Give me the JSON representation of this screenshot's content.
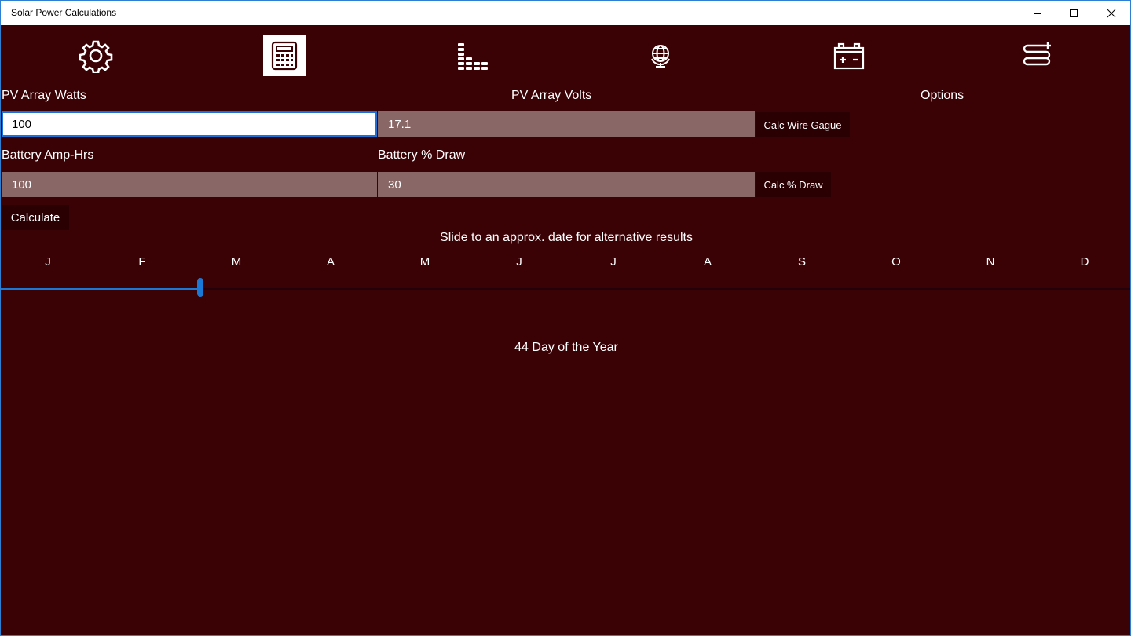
{
  "window": {
    "title": "Solar Power Calculations"
  },
  "labels": {
    "pv_watts": "PV Array Watts",
    "pv_volts": "PV Array Volts",
    "options": "Options",
    "battery_amp_hrs": "Battery Amp-Hrs",
    "battery_draw": "Battery % Draw",
    "slide_hint": "Slide to an approx. date for alternative results",
    "day_suffix": "Day of the Year"
  },
  "fields": {
    "pv_watts": "100",
    "pv_volts": "17.1",
    "battery_amp_hrs": "100",
    "battery_draw": "30"
  },
  "buttons": {
    "calc_wire": "Calc Wire Gague",
    "calc_draw": "Calc % Draw",
    "calculate": "Calculate"
  },
  "months": [
    "J",
    "F",
    "M",
    "A",
    "M",
    "J",
    "J",
    "A",
    "S",
    "O",
    "N",
    "D"
  ],
  "slider": {
    "day_of_year": 44,
    "max_day": 365
  },
  "colors": {
    "background": "#3a0205",
    "accent": "#1a78d6",
    "disabled_field": "#8a6767"
  }
}
